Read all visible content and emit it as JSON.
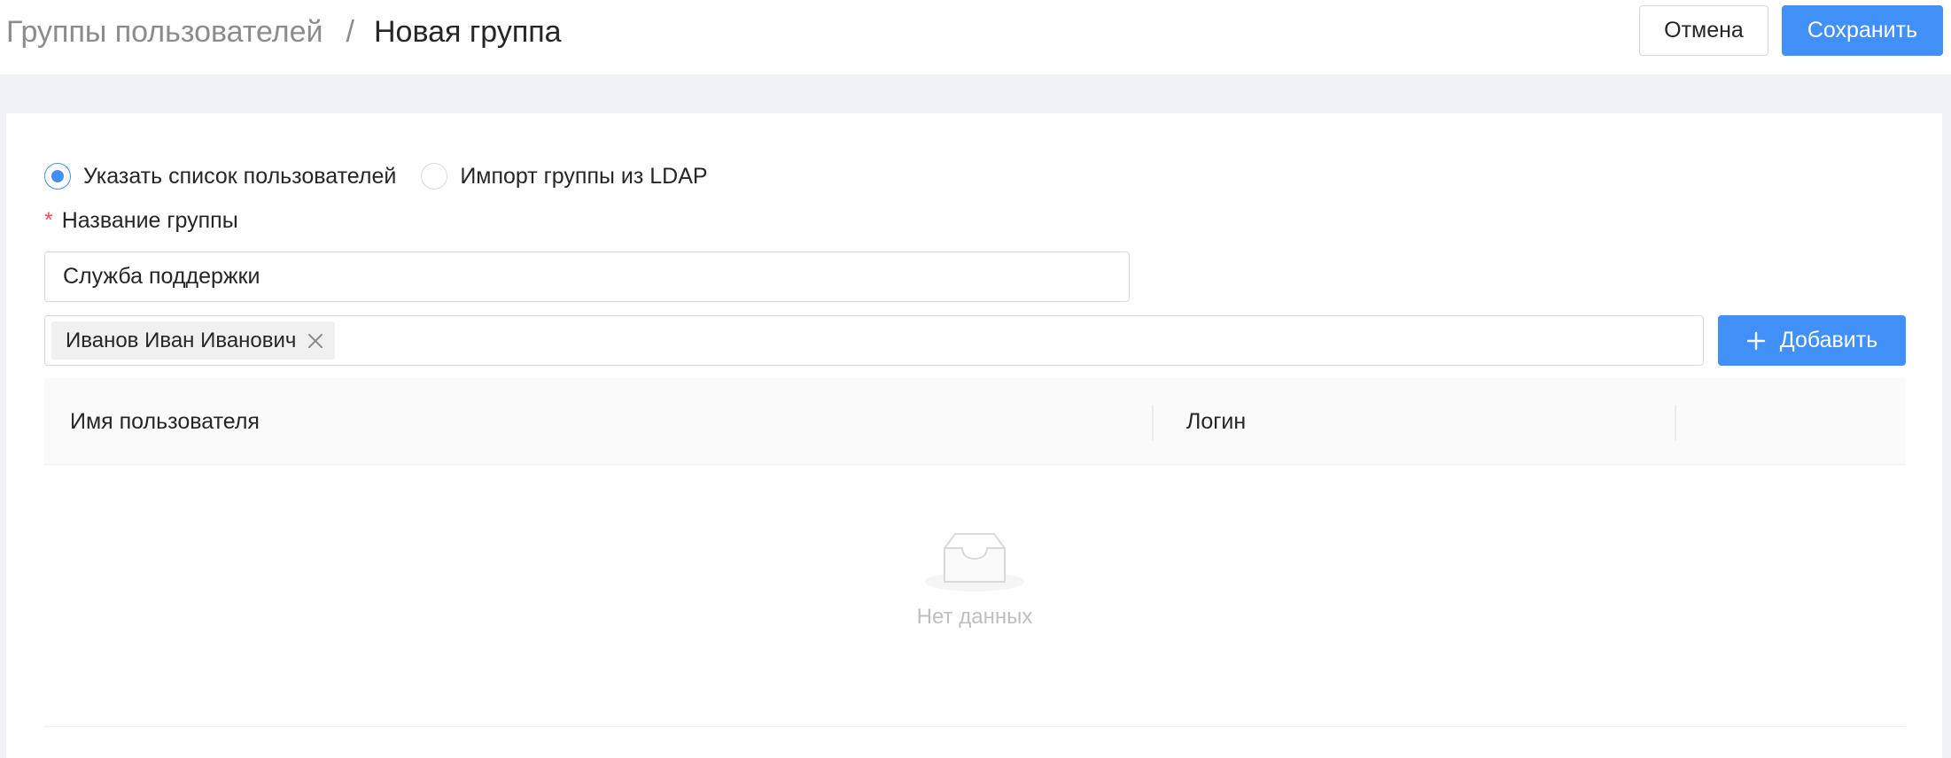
{
  "breadcrumb": {
    "parent": "Группы пользователей",
    "separator": "/",
    "current": "Новая группа"
  },
  "actions": {
    "cancel_label": "Отмена",
    "save_label": "Сохранить"
  },
  "source_options": [
    {
      "label": "Указать список пользователей",
      "selected": true
    },
    {
      "label": "Импорт группы из LDAP",
      "selected": false
    }
  ],
  "group_name": {
    "required_mark": "*",
    "label": "Название группы",
    "value": "Служба поддержки"
  },
  "users_select": {
    "tags": [
      "Иванов Иван Иванович"
    ]
  },
  "add_button": {
    "label": "Добавить",
    "icon": "plus-icon"
  },
  "table": {
    "columns": [
      "Имя пользователя",
      "Логин"
    ],
    "rows": [],
    "empty_text": "Нет данных",
    "empty_icon": "empty-inbox-icon"
  },
  "colors": {
    "primary": "#4190f7",
    "required": "#ff4d4f",
    "muted": "#8c8c8c",
    "background": "#f0f2f5"
  }
}
